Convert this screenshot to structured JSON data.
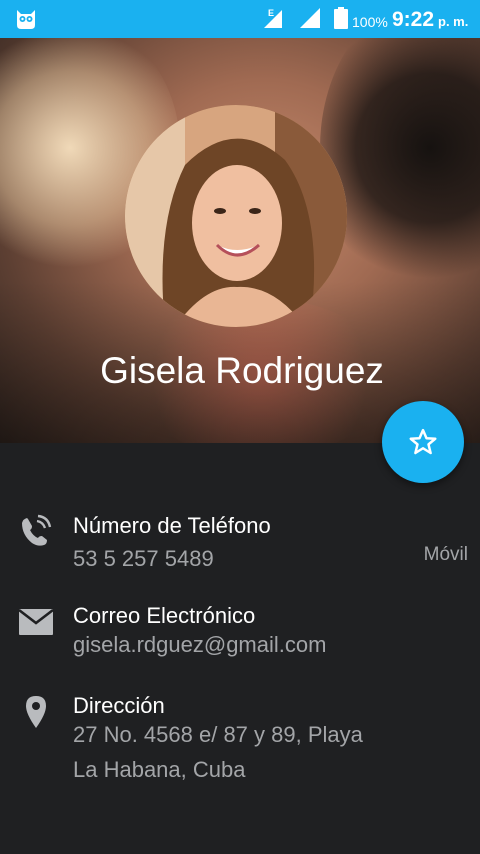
{
  "status_bar": {
    "battery": "100%",
    "time": "9:22",
    "ampm": "p. m.",
    "network_letter": "E"
  },
  "contact": {
    "name": "Gisela Rodriguez"
  },
  "details": {
    "phone": {
      "label": "Número de Teléfono",
      "value": "53 5 257 5489",
      "type": "Móvil"
    },
    "email": {
      "label": "Correo Electrónico",
      "value": "gisela.rdguez@gmail.com"
    },
    "address": {
      "label": "Dirección",
      "line1": "27 No. 4568 e/ 87 y 89, Playa",
      "line2": "La Habana, Cuba"
    }
  },
  "colors": {
    "accent": "#1ab1f0",
    "background": "#1f2022",
    "secondary_text": "#a3a5a8"
  },
  "icons": {
    "status": [
      "owl-app-icon",
      "signal-e-icon",
      "signal-icon",
      "battery-icon"
    ],
    "fab": "star-outline-icon",
    "rows": [
      "phone-ringing-icon",
      "email-icon",
      "location-pin-icon"
    ]
  }
}
